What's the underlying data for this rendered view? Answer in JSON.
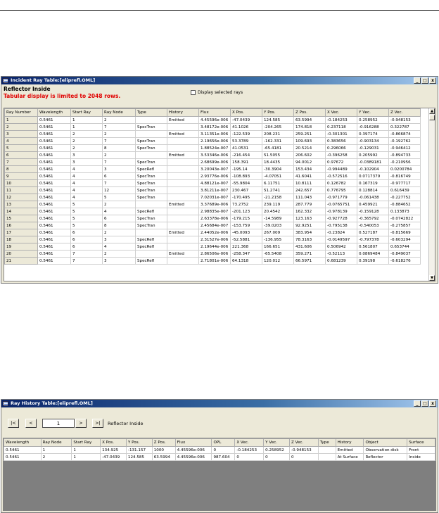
{
  "incident_window": {
    "title": "Incident Ray Table:[eliprefl.OML]",
    "heading": "Reflector Inside",
    "warning": "Tabular display is limited to 2048 rows.",
    "checkbox_label": "Display selected rays",
    "columns": [
      "Ray Number",
      "Wavelength",
      "Start Ray",
      "Ray Node",
      "Type",
      "History",
      "Flux",
      "X Pos.",
      "Y Pos.",
      "Z Pos.",
      "X Vec.",
      "Y Vec.",
      "Z Vec."
    ],
    "rows": [
      [
        "1",
        "0.5461",
        "1",
        "2",
        "",
        "Emitted",
        "4.45596e-006",
        "-47.0439",
        "124.585",
        "63.5994",
        "-0.184253",
        "0.258952",
        "-0.948153"
      ],
      [
        "2",
        "0.5461",
        "1",
        "7",
        "SpecTran",
        "",
        "3.48172e-006",
        "41.1026",
        "-204.265",
        "174.818",
        "0.237118",
        "-0.916288",
        "0.322787"
      ],
      [
        "3",
        "0.5461",
        "2",
        "2",
        "",
        "Emitted",
        "3.11351e-006",
        "-122.539",
        "208.231",
        "259.251",
        "-0.301301",
        "0.397174",
        "-0.866874"
      ],
      [
        "4",
        "0.5461",
        "2",
        "7",
        "SpecTran",
        "",
        "2.19656e-006",
        "53.3789",
        "-162.331",
        "109.693",
        "0.383656",
        "-0.903134",
        "-0.192762"
      ],
      [
        "5",
        "0.5461",
        "2",
        "8",
        "SpecTran",
        "",
        "1.88524e-007",
        "41.0531",
        "-65.4181",
        "20.5214",
        "0.296066",
        "-0.129031",
        "-0.946412"
      ],
      [
        "6",
        "0.5461",
        "3",
        "2",
        "",
        "Emitted",
        "3.53346e-006",
        "-216.454",
        "51.5055",
        "206.602",
        "-0.396258",
        "0.205992",
        "-0.894733"
      ],
      [
        "7",
        "0.5461",
        "3",
        "7",
        "SpecTran",
        "",
        "2.68699e-006",
        "158.391",
        "18.4435",
        "94.0012",
        "0.97672",
        "-0.0389181",
        "-0.210956"
      ],
      [
        "8",
        "0.5461",
        "4",
        "3",
        "SpecRefl",
        "",
        "3.20043e-007",
        "-195.14",
        "-30.3904",
        "153.434",
        "-0.994489",
        "-0.102904",
        "0.0200784"
      ],
      [
        "9",
        "0.5461",
        "4",
        "6",
        "SpecTran",
        "",
        "2.93776e-006",
        "-108.893",
        "-4.07051",
        "41.6041",
        "-0.572516",
        "0.0717379",
        "-0.816749"
      ],
      [
        "10",
        "0.5461",
        "4",
        "7",
        "SpecTran",
        "",
        "4.88121e-007",
        "-55.9804",
        "6.11751",
        "10.8111",
        "0.126782",
        "0.167319",
        "-0.977717"
      ],
      [
        "11",
        "0.5461",
        "4",
        "12",
        "SpecTran",
        "",
        "3.81211e-007",
        "230.467",
        "51.2741",
        "242.657",
        "0.776795",
        "0.128814",
        "0.616439"
      ],
      [
        "12",
        "0.5461",
        "4",
        "5",
        "SpecTran",
        "",
        "7.02031e-007",
        "-170.495",
        "-21.2158",
        "111.043",
        "-0.971779",
        "-0.061438",
        "-0.227752"
      ],
      [
        "13",
        "0.5461",
        "5",
        "2",
        "",
        "Emitted",
        "3.37689e-006",
        "73.2752",
        "239.119",
        "287.779",
        "-0.0765751",
        "0.459921",
        "-0.884652"
      ],
      [
        "14",
        "0.5461",
        "5",
        "4",
        "SpecRefl",
        "",
        "2.98835e-007",
        "-201.123",
        "20.4542",
        "162.332",
        "-0.978139",
        "-0.159128",
        "0.133873"
      ],
      [
        "15",
        "0.5461",
        "5",
        "6",
        "SpecTran",
        "",
        "2.63378e-006",
        "-179.215",
        "-14.5989",
        "123.163",
        "-0.927728",
        "-0.365792",
        "-0.0742822"
      ],
      [
        "16",
        "0.5461",
        "5",
        "8",
        "SpecTran",
        "",
        "2.45684e-007",
        "-153.759",
        "-39.0203",
        "92.9251",
        "-0.795138",
        "-0.540053",
        "-0.275857"
      ],
      [
        "17",
        "0.5461",
        "6",
        "2",
        "",
        "Emitted",
        "2.44052e-006",
        "-45.0093",
        "267.009",
        "383.954",
        "-0.23824",
        "0.527187",
        "-0.815669"
      ],
      [
        "18",
        "0.5461",
        "6",
        "3",
        "SpecRefl",
        "",
        "2.31527e-006",
        "-52.5881",
        "-136.955",
        "78.3163",
        "-0.0149597",
        "-0.797378",
        "-0.603294"
      ],
      [
        "19",
        "0.5461",
        "6",
        "4",
        "SpecRefl",
        "",
        "2.19644e-006",
        "221.368",
        "166.651",
        "431.606",
        "0.506942",
        "0.561807",
        "0.653744"
      ],
      [
        "20",
        "0.5461",
        "7",
        "2",
        "",
        "Emitted",
        "2.86506e-006",
        "-258.347",
        "-65.5408",
        "359.271",
        "-0.52113",
        "0.0869484",
        "-0.849037"
      ],
      [
        "21",
        "0.5461",
        "7",
        "3",
        "SpecRefl",
        "",
        "2.71801e-006",
        "64.1318",
        "120.012",
        "66.5971",
        "0.681239",
        "0.39198",
        "-0.618276"
      ]
    ]
  },
  "history_window": {
    "title": "Ray History Table:[eliprefl.OML]",
    "nav": {
      "first": "|<",
      "prev": "<",
      "page": "1",
      "next": ">",
      "last": ">|",
      "label": "Reflector Inside"
    },
    "columns": [
      "Wavelength",
      "Ray Node",
      "Start Ray",
      "X Pos.",
      "Y Pos.",
      "Z Pos.",
      "Flux",
      "OPL",
      "X Vec.",
      "Y Vec.",
      "Z Vec.",
      "Type",
      "History",
      "Object",
      "Surface"
    ],
    "rows": [
      [
        "0.5461",
        "1",
        "1",
        "134.925",
        "-131.157",
        "1000",
        "4.45596e-006",
        "0",
        "-0.184253",
        "0.258952",
        "-0.948153",
        "",
        "Emitted",
        "Observation disk",
        "Front"
      ],
      [
        "0.5461",
        "2",
        "1",
        "-47.0439",
        "124.585",
        "63.5994",
        "4.45596e-006",
        "987.604",
        "0",
        "0",
        "0",
        "",
        "At Surface",
        "Reflector",
        "Inside"
      ]
    ]
  },
  "window_buttons": {
    "minimize": "_",
    "maximize": "□",
    "close": "x"
  }
}
